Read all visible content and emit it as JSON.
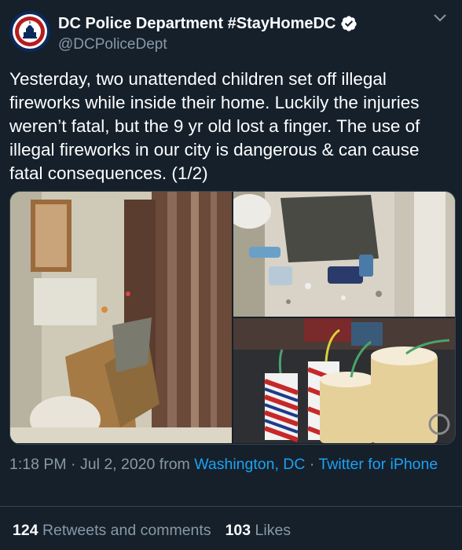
{
  "account": {
    "display_name": "DC Police Department #StayHomeDC",
    "handle": "@DCPoliceDept",
    "verified": true,
    "avatar_icon": "police-seal-icon"
  },
  "tweet": {
    "text": "Yesterday, two unattended children set off illegal fireworks while inside their home. Luckily the injuries weren’t fatal, but the 9 yr old lost a finger. The use of illegal fireworks in our city is dangerous & can cause fatal consequences. (1/2)"
  },
  "media": [
    {
      "name": "photo-bathroom-damage"
    },
    {
      "name": "photo-floor-debris"
    },
    {
      "name": "photo-fireworks"
    }
  ],
  "meta": {
    "time": "1:18 PM",
    "dot1": " · ",
    "date": "Jul 2, 2020",
    "from": " from ",
    "location": "Washington, DC",
    "dot2": " · ",
    "source": "Twitter for iPhone"
  },
  "stats": {
    "retweets_count": "124",
    "retweets_label": "Retweets and comments",
    "likes_count": "103",
    "likes_label": "Likes"
  },
  "colors": {
    "background": "#15202b",
    "text": "#ffffff",
    "secondary": "#8899a6",
    "link": "#1da1f2",
    "divider": "#38444d"
  }
}
